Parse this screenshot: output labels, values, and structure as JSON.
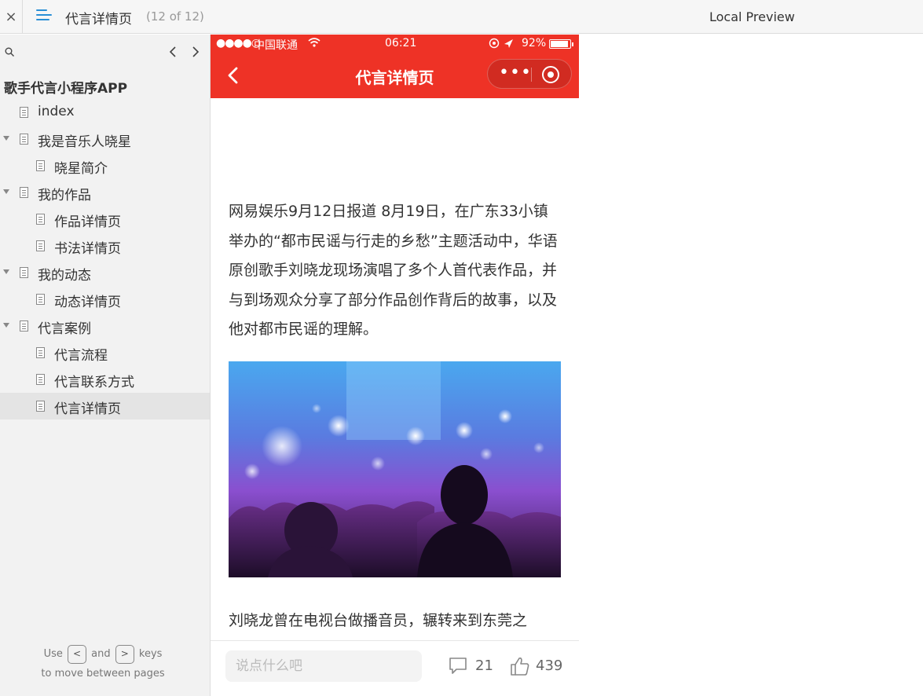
{
  "topbar": {
    "close_glyph": "×",
    "title": "代言详情页",
    "count": "(12 of 12)",
    "preview_label": "Local Preview"
  },
  "sidebar": {
    "book_title": "歌手代言小程序APP",
    "items": [
      {
        "label": "index",
        "level": 1,
        "expanded": false
      },
      {
        "label": "我是音乐人晓星",
        "level": 1,
        "expanded": true
      },
      {
        "label": "晓星简介",
        "level": 2
      },
      {
        "label": "我的作品",
        "level": 1,
        "expanded": true
      },
      {
        "label": "作品详情页",
        "level": 2
      },
      {
        "label": "书法详情页",
        "level": 2
      },
      {
        "label": "我的动态",
        "level": 1,
        "expanded": true
      },
      {
        "label": "动态详情页",
        "level": 2
      },
      {
        "label": "代言案例",
        "level": 1,
        "expanded": true
      },
      {
        "label": "代言流程",
        "level": 2
      },
      {
        "label": "代言联系方式",
        "level": 2
      },
      {
        "label": "代言详情页",
        "level": 2,
        "active": true
      }
    ],
    "hint": {
      "use": "Use",
      "and": "and",
      "keys": "keys",
      "line2": "to move between pages",
      "prev_key": "<",
      "next_key": ">"
    }
  },
  "phone": {
    "status": {
      "dots": "●●●●○",
      "carrier": "中国联通",
      "time": "06:21",
      "battery_pct": "92%"
    },
    "nav_title": "代言详情页",
    "article_para1": "网易娱乐9月12日报道 8月19日，在广东33小镇举办的“都市民谣与行走的乡愁”主题活动中，华语原创歌手刘晓龙现场演唱了多个人首代表作品，并与到场观众分享了部分作品创作背后的故事，以及他对都市民谣的理解。",
    "article_para2": "刘晓龙曾在电视台做播音员，辗转来到东莞之",
    "bottom": {
      "comment_placeholder": "说点什么吧",
      "comment_count": "21",
      "like_count": "439"
    }
  },
  "colors": {
    "accent_red": "#ee3226",
    "menu_blue": "#2a8fd6"
  }
}
